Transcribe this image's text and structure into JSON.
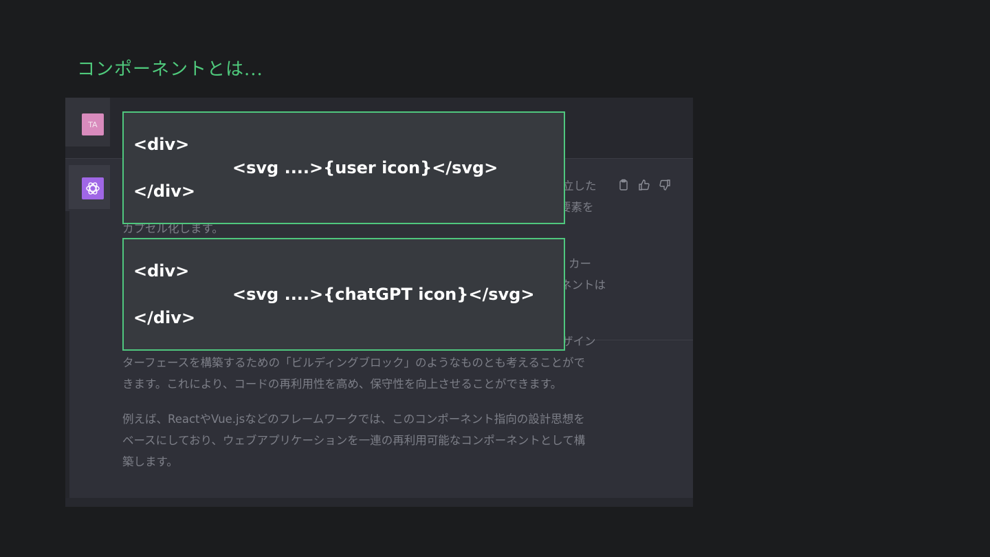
{
  "slide": {
    "title": "コンポーネントとは..."
  },
  "chat": {
    "user_avatar_initials": "TA",
    "assistant_avatar_icon": "chatgpt-logo-icon",
    "actions": [
      "copy-icon",
      "thumbs-up-icon",
      "thumbs-down-icon"
    ],
    "visible_text": {
      "p1_line1_tail": "立した",
      "p1_line2_tail": "要素を",
      "p1_line3": "カプセル化します。",
      "p2_line1_tail": "カー",
      "p2_line2_tail": "ネントは",
      "p3_line1_tail": "ザイン",
      "p3_line2": "ターフェースを構築するための「ビルディングブロック」のようなものとも考えることがで",
      "p3_line3": "きます。これにより、コードの再利用性を高め、保守性を向上させることができます。",
      "p4_line1": "例えば、ReactやVue.jsなどのフレームワークでは、このコンポーネント指向の設計思想を",
      "p4_line2": "ベースにしており、ウェブアプリケーションを一連の再利用可能なコンポーネントとして構",
      "p4_line3": "築します。"
    }
  },
  "overlays": [
    {
      "line1": "<div>",
      "line2": "<svg ....>{user icon}</svg>",
      "line3": "</div>"
    },
    {
      "line1": "<div>",
      "line2": "<svg ....>{chatGPT icon}</svg>",
      "line3": "</div>"
    }
  ],
  "colors": {
    "accent_green": "#4fca7c",
    "user_avatar_bg": "#d98bbd",
    "assistant_avatar_bg": "#a067e6"
  }
}
